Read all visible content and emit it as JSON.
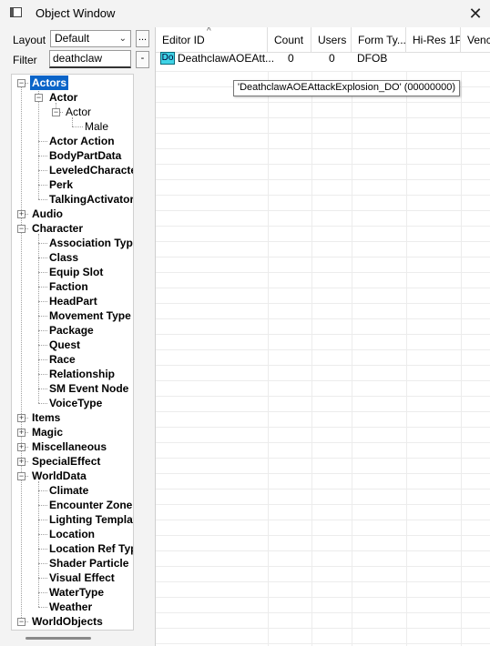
{
  "window": {
    "title": "Object Window"
  },
  "controls": {
    "layout_label": "Layout",
    "layout_value": "Default",
    "layout_more_label": "...",
    "filter_label": "Filter",
    "filter_value": "deathclaw",
    "filter_clear_label": "-"
  },
  "tree": {
    "items": [
      {
        "label": "Actors",
        "selected": true,
        "bold": true,
        "expanded": true
      },
      {
        "label": "Actor",
        "bold": true,
        "expanded": true
      },
      {
        "label": "Actor",
        "bold": false,
        "expanded": true
      },
      {
        "label": "Male",
        "bold": false
      },
      {
        "label": "Actor Action",
        "bold": true
      },
      {
        "label": "BodyPartData",
        "bold": true
      },
      {
        "label": "LeveledCharacter",
        "bold": true
      },
      {
        "label": "Perk",
        "bold": true
      },
      {
        "label": "TalkingActivator",
        "bold": true
      },
      {
        "label": "Audio",
        "bold": true,
        "expanded": false
      },
      {
        "label": "Character",
        "bold": true,
        "expanded": true
      },
      {
        "label": "Association Type",
        "bold": true
      },
      {
        "label": "Class",
        "bold": true
      },
      {
        "label": "Equip Slot",
        "bold": true
      },
      {
        "label": "Faction",
        "bold": true
      },
      {
        "label": "HeadPart",
        "bold": true
      },
      {
        "label": "Movement Type",
        "bold": true
      },
      {
        "label": "Package",
        "bold": true
      },
      {
        "label": "Quest",
        "bold": true
      },
      {
        "label": "Race",
        "bold": true
      },
      {
        "label": "Relationship",
        "bold": true
      },
      {
        "label": "SM Event Node",
        "bold": true
      },
      {
        "label": "VoiceType",
        "bold": true
      },
      {
        "label": "Items",
        "bold": true,
        "expanded": false
      },
      {
        "label": "Magic",
        "bold": true,
        "expanded": false
      },
      {
        "label": "Miscellaneous",
        "bold": true,
        "expanded": false
      },
      {
        "label": "SpecialEffect",
        "bold": true,
        "expanded": false
      },
      {
        "label": "WorldData",
        "bold": true,
        "expanded": true
      },
      {
        "label": "Climate",
        "bold": true
      },
      {
        "label": "Encounter Zone",
        "bold": true
      },
      {
        "label": "Lighting Template",
        "bold": true
      },
      {
        "label": "Location",
        "bold": true
      },
      {
        "label": "Location Ref Type",
        "bold": true
      },
      {
        "label": "Shader Particle",
        "bold": true
      },
      {
        "label": "Visual Effect",
        "bold": true
      },
      {
        "label": "WaterType",
        "bold": true
      },
      {
        "label": "Weather",
        "bold": true
      },
      {
        "label": "WorldObjects",
        "bold": true,
        "expanded": true
      }
    ]
  },
  "grid": {
    "columns": [
      "Editor ID",
      "Count",
      "Users",
      "Form Ty...",
      "Hi-Res 1P",
      "Venc"
    ],
    "rows": [
      {
        "icon_text": "Do",
        "editor_id": "DeathclawAOEAtt...",
        "count": "0",
        "users": "0",
        "form_type": "DFOB",
        "hires": "",
        "vendor": ""
      }
    ],
    "tooltip": "'DeathclawAOEAttackExplosion_DO' (00000000)"
  }
}
